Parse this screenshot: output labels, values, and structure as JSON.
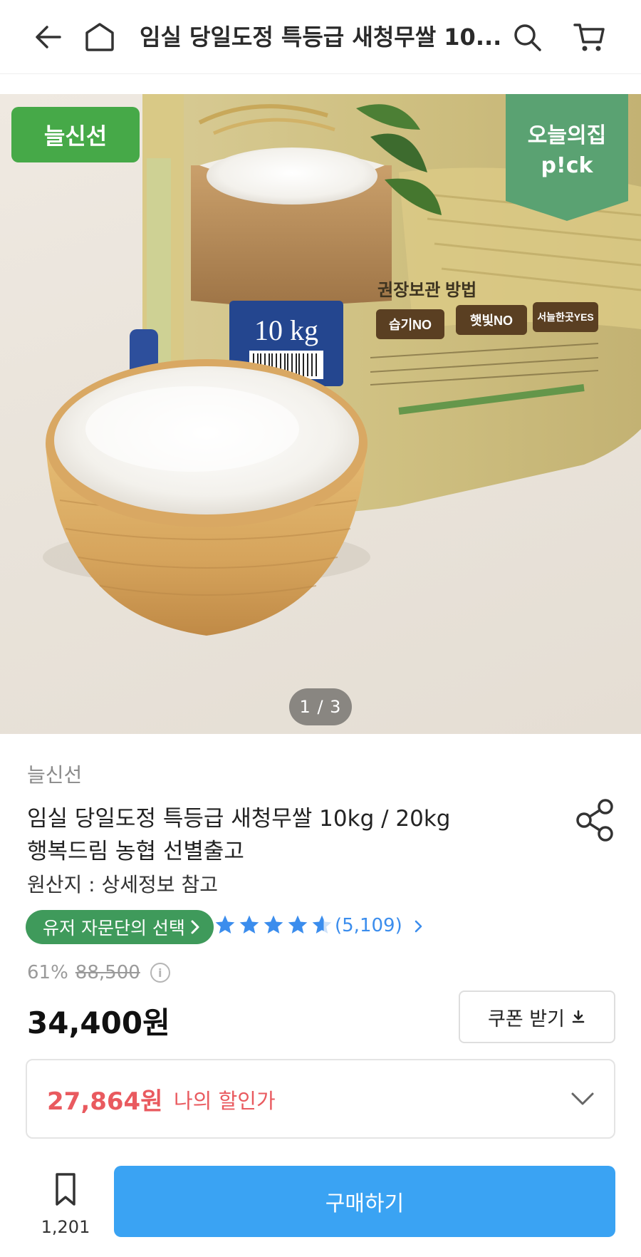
{
  "header": {
    "title": "임실 당일도정 특등급 새청무쌀 10...",
    "back_icon": "arrow-left-icon",
    "home_icon": "home-icon",
    "search_icon": "search-icon",
    "cart_icon": "cart-icon"
  },
  "hero": {
    "badge_left": "늘신선",
    "badge_right_line1": "오늘의집",
    "badge_right_line2": "p!ck",
    "pager": "1 / 3",
    "package_weight": "10 kg",
    "storage_title": "권장보관 방법",
    "storage_items": [
      "습기NO",
      "햇빛NO",
      "서늘한곳YES"
    ],
    "badge_left_color": "#46a948",
    "badge_right_color": "#5aa272"
  },
  "product": {
    "brand": "늘신선",
    "title_line1": "임실 당일도정 특등급 새청무쌀 10kg / 20kg",
    "title_line2": "행복드림 농협 선별출고",
    "origin": "원산지 : 상세정보 참고",
    "share_icon": "share-icon",
    "advisor_pill": "유저 자문단의 선택",
    "rating": 4.5,
    "review_count": "(5,109)",
    "discount_rate": "61%",
    "original_price": "88,500",
    "price": "34,400원",
    "coupon_label": "쿠폰 받기",
    "my_price": "27,864원",
    "my_price_label": "나의 할인가",
    "accent_color": "#e95a5f",
    "pill_color": "#3f9a5b",
    "star_color": "#3b8ded"
  },
  "bottom": {
    "bookmark_count": "1,201",
    "buy_label": "구매하기",
    "buy_color": "#3aa3f3"
  }
}
